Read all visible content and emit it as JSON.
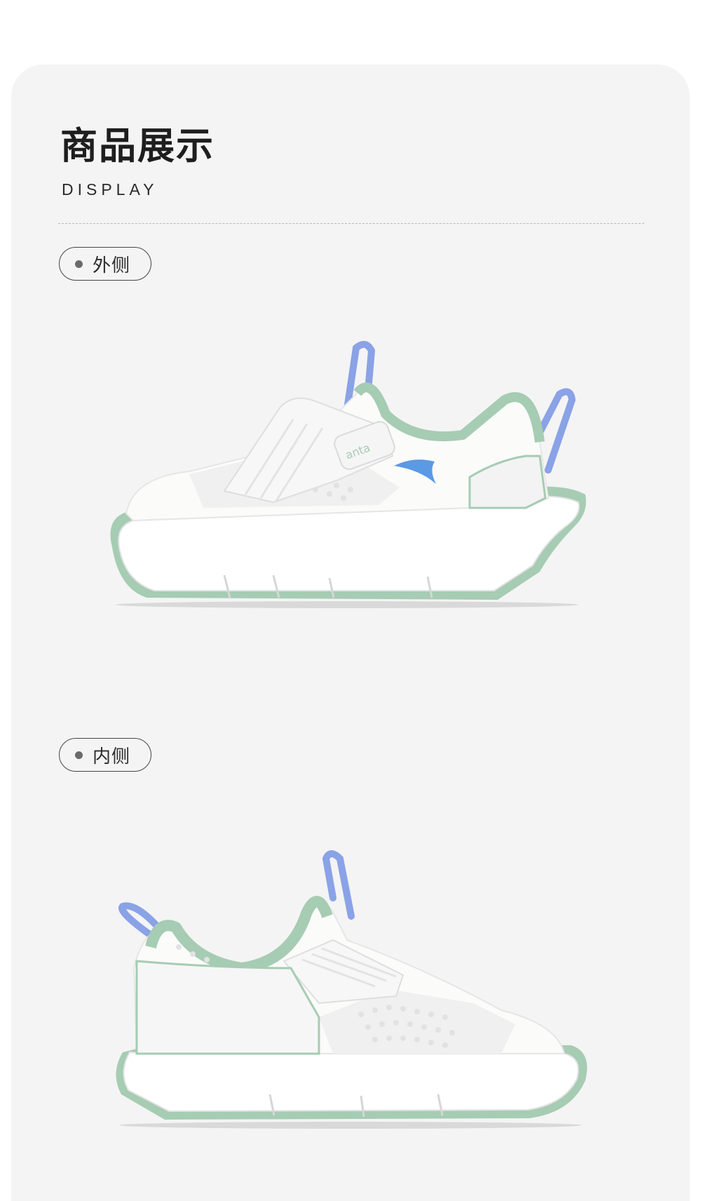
{
  "header": {
    "title": "商品展示",
    "subtitle": "DISPLAY"
  },
  "views": [
    {
      "label": "外侧"
    },
    {
      "label": "内侧"
    }
  ],
  "shoe": {
    "brand_logo_text": "anta"
  },
  "colors": {
    "page_background": "#ffffff",
    "card_background": "#f4f4f4",
    "shoe_white": "#fbfbfa",
    "mint_trim": "#a6ccb3",
    "periwinkle_loop": "#8aa2e6",
    "logo_blue": "#5b9ae4"
  }
}
